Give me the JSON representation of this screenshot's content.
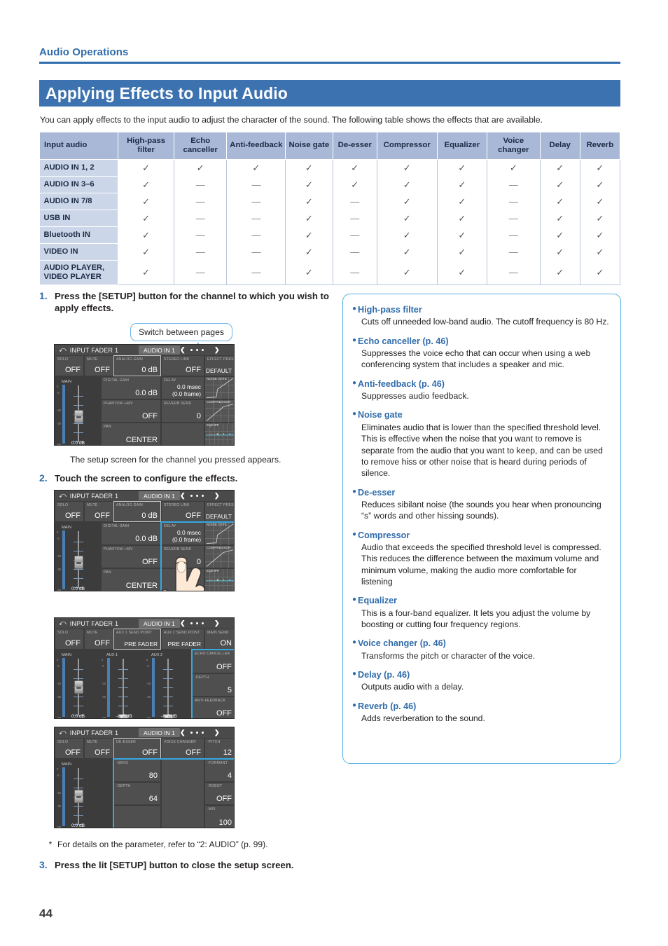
{
  "runhead": {
    "text": "Audio Operations"
  },
  "banner": {
    "title": "Applying Effects to Input Audio"
  },
  "lede": {
    "text": "You can apply effects to the input audio to adjust the character of the sound. The following table shows the effects that are available."
  },
  "table": {
    "columns": [
      "Input audio",
      "High-pass filter",
      "Echo canceller",
      "Anti-feedback",
      "Noise gate",
      "De-esser",
      "Compressor",
      "Equalizer",
      "Voice changer",
      "Delay",
      "Reverb"
    ],
    "check_glyph": "✓",
    "dash_glyph": "—",
    "rows": [
      {
        "label": "AUDIO IN 1, 2",
        "cells": [
          "y",
          "y",
          "y",
          "y",
          "y",
          "y",
          "y",
          "y",
          "y",
          "y"
        ]
      },
      {
        "label": "AUDIO IN 3–6",
        "cells": [
          "y",
          "n",
          "n",
          "y",
          "y",
          "y",
          "y",
          "n",
          "y",
          "y"
        ]
      },
      {
        "label": "AUDIO IN 7/8",
        "cells": [
          "y",
          "n",
          "n",
          "y",
          "n",
          "y",
          "y",
          "n",
          "y",
          "y"
        ]
      },
      {
        "label": "USB IN",
        "cells": [
          "y",
          "n",
          "n",
          "y",
          "n",
          "y",
          "y",
          "n",
          "y",
          "y"
        ]
      },
      {
        "label": "Bluetooth IN",
        "cells": [
          "y",
          "n",
          "n",
          "y",
          "n",
          "y",
          "y",
          "n",
          "y",
          "y"
        ]
      },
      {
        "label": "VIDEO IN",
        "cells": [
          "y",
          "n",
          "n",
          "y",
          "n",
          "y",
          "y",
          "n",
          "y",
          "y"
        ]
      },
      {
        "label": "AUDIO PLAYER, VIDEO PLAYER",
        "cells": [
          "y",
          "n",
          "n",
          "y",
          "n",
          "y",
          "y",
          "n",
          "y",
          "y"
        ]
      }
    ]
  },
  "steps": {
    "step1_num": "1.",
    "step1_text": "Press the [SETUP] button for the channel to which you wish to apply effects.",
    "step1_result": "The setup screen for the channel you pressed appears.",
    "step2_num": "2.",
    "step2_text": "Touch the screen to configure the effects.",
    "note_star": "*",
    "note_text": "For details on the parameter, refer to “2: AUDIO” (p. 99).",
    "step3_num": "3.",
    "step3_text": "Press the lit [SETUP] button to close the setup screen."
  },
  "callout": {
    "text": "Switch between pages"
  },
  "device": {
    "back_glyph": "⤺",
    "title": "INPUT FADER 1",
    "channel": "AUDIO IN 1",
    "arrow_left": "❮",
    "arrow_right": "❯",
    "screen1": {
      "solo_label": "SOLO",
      "solo_value": "OFF",
      "mute_label": "MUTE",
      "mute_value": "OFF",
      "analog_gain_label": "ANALOG GAIN",
      "analog_gain_value": "0 dB",
      "stereo_link_label": "STEREO LINK",
      "stereo_link_value": "OFF",
      "effect_preset_label": "EFFECT PRESET",
      "effect_preset_value": "DEFAULT",
      "digital_gain_label": "DIGITAL GAIN",
      "digital_gain_value": "0.0 dB",
      "delay_label": "DELAY",
      "delay_value1": "0.0 msec",
      "delay_value2": "(0.0 frame)",
      "phantom_label": "PHANTOM +48V",
      "phantom_value": "OFF",
      "reverb_send_label": "REVERB SEND",
      "reverb_send_value": "0",
      "pan_label": "PAN",
      "pan_value": "CENTER",
      "main_label": "MAIN",
      "main_db": "0.0 dB",
      "noise_gate_label": "NOISE GATE",
      "compressor_label": "COMPRESSOR",
      "eq_label": "EQ/HPF",
      "scale": [
        "0",
        "-6",
        "-20",
        "-30",
        "-90"
      ]
    },
    "screen3": {
      "solo_label": "SOLO",
      "solo_value": "OFF",
      "mute_label": "MUTE",
      "mute_value": "OFF",
      "aux1_point_label": "AUX 1 SEND POINT",
      "aux1_point_value": "PRE FADER",
      "aux2_point_label": "AUX 2 SEND POINT",
      "aux2_point_value": "PRE FADER",
      "main_send_label": "MAIN SEND",
      "main_send_value": "ON",
      "echo_canceller_label": "ECHO CANCELLER",
      "echo_canceller_value": "OFF",
      "depth_label": "-DEPTH",
      "depth_value": "5",
      "anti_feedback_label": "ANTI-FEEDBACK",
      "anti_feedback_value": "OFF",
      "main_label": "MAIN",
      "main_db": "0.0 dB",
      "aux1_label": "AUX 1",
      "aux1_db": "-INF dB",
      "aux2_label": "AUX 2",
      "aux2_db": "-INF dB"
    },
    "screen4": {
      "solo_label": "SOLO",
      "solo_value": "OFF",
      "mute_label": "MUTE",
      "mute_value": "OFF",
      "de_esser_label": "DE-ESSER",
      "de_esser_value": "OFF",
      "sens_label": "-SENS",
      "sens_value": "80",
      "depth_label": "-DEPTH",
      "depth_value": "64",
      "voice_changer_label": "VOICE CHANGER",
      "voice_changer_value": "OFF",
      "pitch_label": "-PITCH",
      "pitch_value": "12",
      "formant_label": "-FORMANT",
      "formant_value": "4",
      "robot_label": "-ROBOT",
      "robot_value": "OFF",
      "mix_label": "-MIX",
      "mix_value": "100",
      "main_label": "MAIN",
      "main_db": "0.0 dB"
    }
  },
  "infobox": {
    "entries": [
      {
        "head": "High-pass filter",
        "body": "Cuts off unneeded low-band audio. The cutoff frequency is 80 Hz."
      },
      {
        "head": "Echo canceller (p. 46)",
        "body": "Suppresses the voice echo that can occur when using a web conferencing system that includes a speaker and mic."
      },
      {
        "head": "Anti-feedback (p. 46)",
        "body": "Suppresses audio feedback."
      },
      {
        "head": "Noise gate",
        "body": "Eliminates audio that is lower than the specified threshold level. This is effective when the noise that you want to remove is separate from the audio that you want to keep, and can be used to remove hiss or other noise that is heard during periods of silence."
      },
      {
        "head": "De-esser",
        "body": "Reduces sibilant noise (the sounds you hear when pronouncing “s” words and other hissing sounds)."
      },
      {
        "head": "Compressor",
        "body": "Audio that exceeds the specified threshold level is compressed. This reduces the difference between the maximum volume and minimum volume, making the audio more comfortable for listening"
      },
      {
        "head": "Equalizer",
        "body": "This is a four-band equalizer. It lets you adjust the volume by boosting or cutting four frequency regions."
      },
      {
        "head": "Voice changer (p. 46)",
        "body": "Transforms the pitch or character of the voice."
      },
      {
        "head": "Delay (p. 46)",
        "body": "Outputs audio with a delay."
      },
      {
        "head": "Reverb (p. 46)",
        "body": "Adds reverberation to the sound."
      }
    ],
    "bullet": "●"
  },
  "page_number": "44",
  "colors": {
    "accent_blue": "#2f6cab",
    "banner_blue": "#3b72af",
    "table_header": "#a8b8d6",
    "table_rowhead": "#ccd6e9",
    "callout_blue": "#56b0e4",
    "highlight_cyan": "#35a8e0"
  }
}
